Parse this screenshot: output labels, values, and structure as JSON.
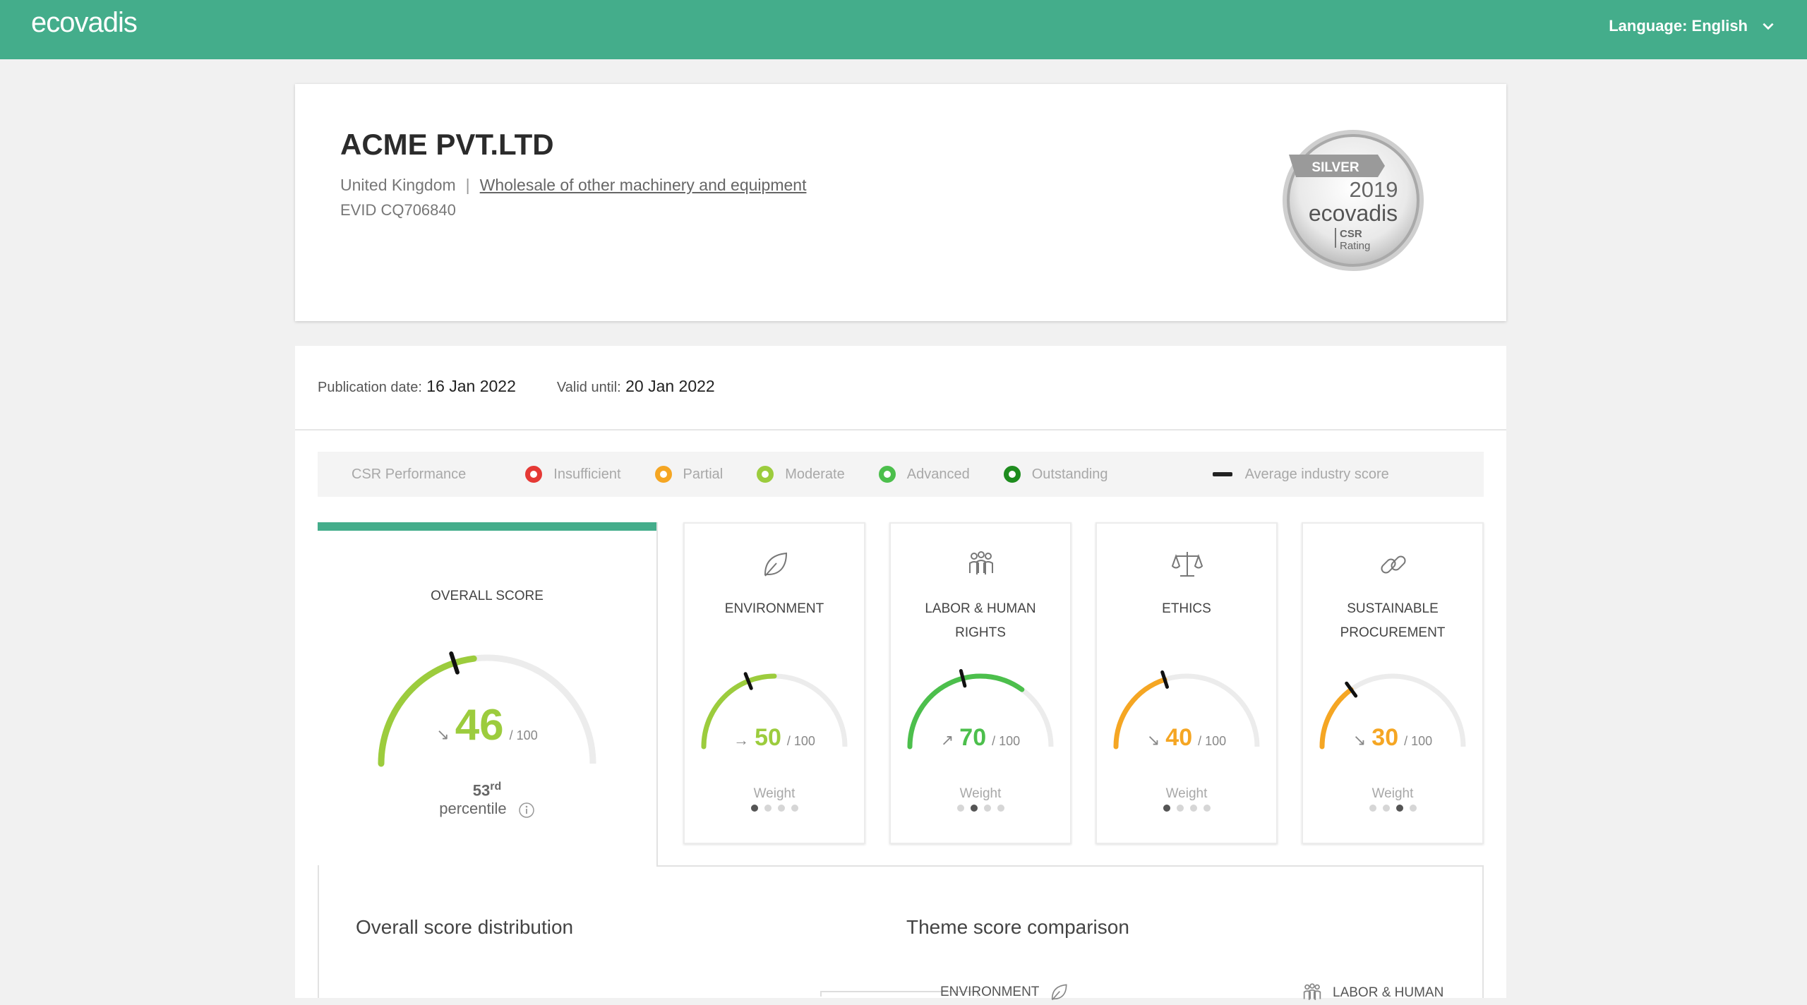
{
  "topbar": {
    "logo": "ecovadis",
    "language_label": "Language: English",
    "bg_color": "#44ad8b"
  },
  "company": {
    "name": "ACME PVT.LTD",
    "country": "United Kingdom",
    "separator": "|",
    "industry": "Wholesale of other machinery and equipment",
    "evid": "EVID CQ706840"
  },
  "medal": {
    "level": "SILVER",
    "year": "2019",
    "brand": "ecovadis",
    "caption_line1": "CSR",
    "caption_line2": "Rating"
  },
  "publication": {
    "pub_label": "Publication date:",
    "pub_value": "16 Jan 2022",
    "valid_label": "Valid until:",
    "valid_value": "20 Jan 2022"
  },
  "legend": {
    "title": "CSR Performance",
    "items": [
      {
        "label": "Insufficient",
        "color": "#e53935"
      },
      {
        "label": "Partial",
        "color": "#f5a623"
      },
      {
        "label": "Moderate",
        "color": "#9ccc3d"
      },
      {
        "label": "Advanced",
        "color": "#4cbf4c"
      },
      {
        "label": "Outstanding",
        "color": "#1e8c1e"
      }
    ],
    "avg_label": "Average industry score"
  },
  "overall": {
    "title": "OVERALL SCORE",
    "score": "46",
    "out_of": "/ 100",
    "score_value": 46,
    "industry_avg": 40,
    "trend_arrow": "↘",
    "color": "#9ccc3d",
    "percentile_num": "53",
    "percentile_sup": "rd",
    "percentile_label": "percentile"
  },
  "themes": [
    {
      "title_line1": "ENVIRONMENT",
      "title_line2": "",
      "icon": "leaf-icon",
      "score": "50",
      "score_value": 50,
      "industry_avg": 38,
      "out_of": "/ 100",
      "arrow": "→",
      "color": "#9ccc3d",
      "weight_label": "Weight",
      "weight": 1
    },
    {
      "title_line1": "LABOR & HUMAN",
      "title_line2": "RIGHTS",
      "icon": "people-icon",
      "score": "70",
      "score_value": 70,
      "industry_avg": 42,
      "out_of": "/ 100",
      "arrow": "↗",
      "color": "#4cbf4c",
      "weight_label": "Weight",
      "weight": 2
    },
    {
      "title_line1": "ETHICS",
      "title_line2": "",
      "icon": "scales-icon",
      "score": "40",
      "score_value": 40,
      "industry_avg": 40,
      "out_of": "/ 100",
      "arrow": "↘",
      "color": "#f5a623",
      "weight_label": "Weight",
      "weight": 1
    },
    {
      "title_line1": "SUSTAINABLE",
      "title_line2": "PROCUREMENT",
      "icon": "chain-link-icon",
      "score": "30",
      "score_value": 30,
      "industry_avg": 30,
      "out_of": "/ 100",
      "arrow": "↘",
      "color": "#f5a623",
      "weight_label": "Weight",
      "weight": 3
    }
  ],
  "sections": {
    "distribution_title": "Overall score distribution",
    "comparison_title": "Theme score comparison",
    "cmp_env": "ENVIRONMENT",
    "cmp_labor": "LABOR & HUMAN"
  }
}
